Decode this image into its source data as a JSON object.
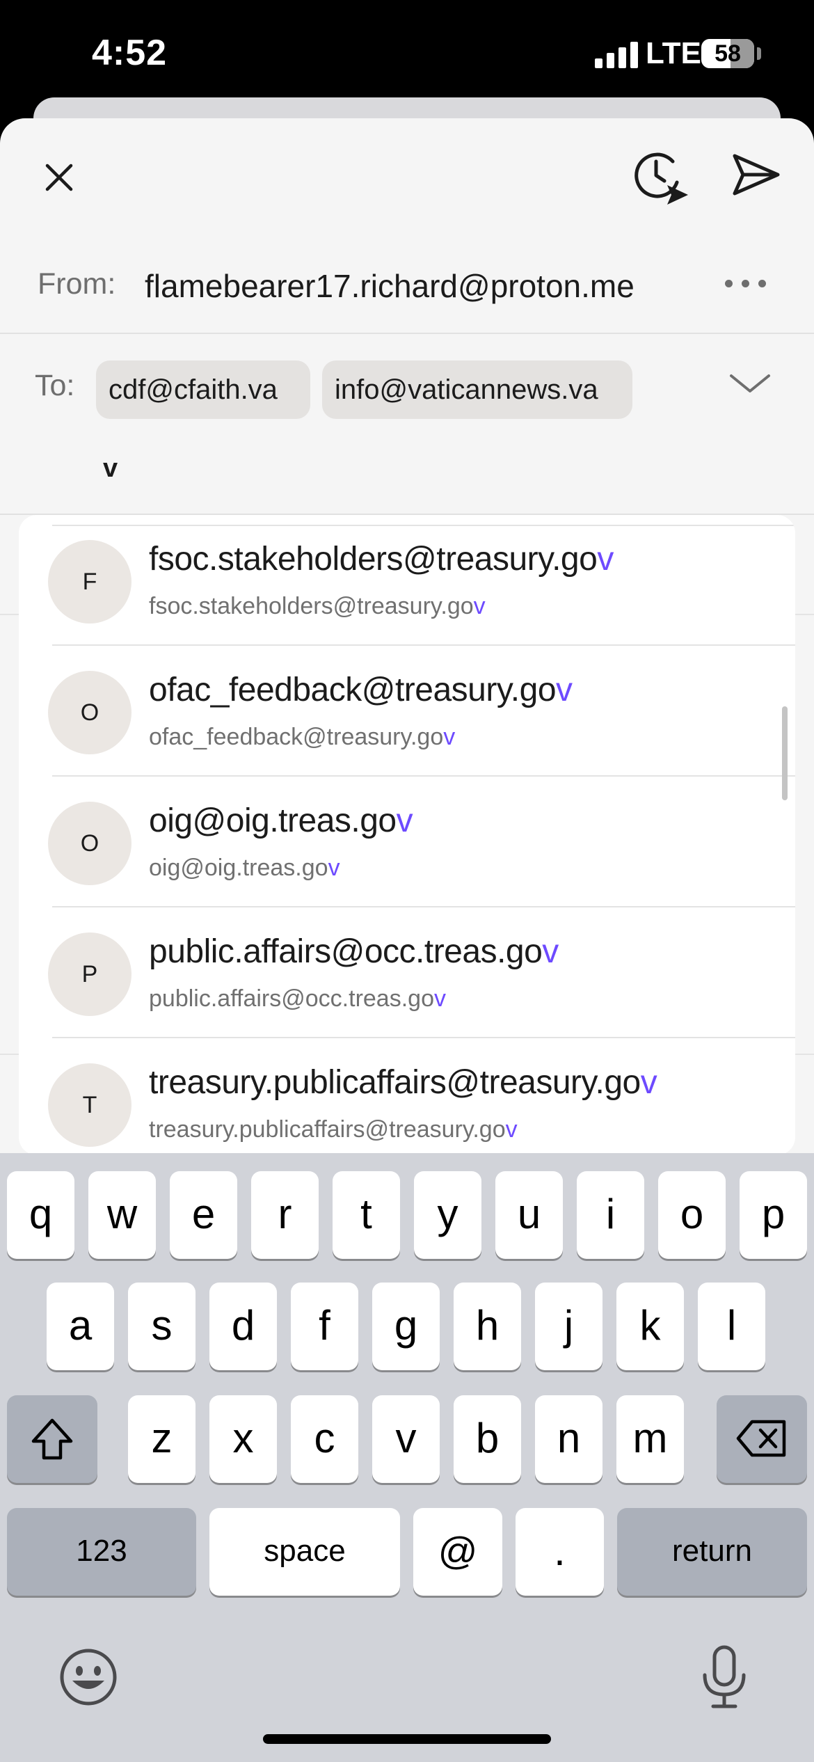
{
  "status_bar": {
    "time": "4:52",
    "network": "LTE",
    "battery": "58"
  },
  "compose": {
    "from_label": "From:",
    "from_address": "flamebearer17.richard@proton.me",
    "to_label": "To:",
    "recipients": [
      "cdf@cfaith.va",
      "info@vaticannews.va"
    ],
    "to_input_value": "v"
  },
  "suggestions": [
    {
      "initial": "F",
      "name_prefix": "fsoc.stakeholders@treasury.go",
      "email_prefix": "fsoc.stakeholders@treasury.go",
      "match": "v"
    },
    {
      "initial": "O",
      "name_prefix": "ofac_feedback@treasury.go",
      "email_prefix": "ofac_feedback@treasury.go",
      "match": "v"
    },
    {
      "initial": "O",
      "name_prefix": "oig@oig.treas.go",
      "email_prefix": "oig@oig.treas.go",
      "match": "v"
    },
    {
      "initial": "P",
      "name_prefix": "public.affairs@occ.treas.go",
      "email_prefix": "public.affairs@occ.treas.go",
      "match": "v"
    },
    {
      "initial": "T",
      "name_prefix": "treasury.publicaffairs@treasury.go",
      "email_prefix": "treasury.publicaffairs@treasury.go",
      "match": "v"
    }
  ],
  "keyboard": {
    "row1": [
      "q",
      "w",
      "e",
      "r",
      "t",
      "y",
      "u",
      "i",
      "o",
      "p"
    ],
    "row2": [
      "a",
      "s",
      "d",
      "f",
      "g",
      "h",
      "j",
      "k",
      "l"
    ],
    "row3": [
      "z",
      "x",
      "c",
      "v",
      "b",
      "n",
      "m"
    ],
    "numbers": "123",
    "space": "space",
    "at": "@",
    "period": ".",
    "return": "return"
  },
  "icons": {
    "close": "close-icon",
    "schedule": "schedule-send-icon",
    "send": "send-icon",
    "more": "more-horizontal-icon",
    "expand": "chevron-down-icon",
    "shift": "shift-icon",
    "delete": "backspace-icon",
    "emoji": "emoji-icon",
    "mic": "microphone-icon"
  },
  "colors": {
    "accent": "#6d4aff",
    "keyboard_bg": "#d1d3d9",
    "chip_bg": "#e4e2e0"
  }
}
